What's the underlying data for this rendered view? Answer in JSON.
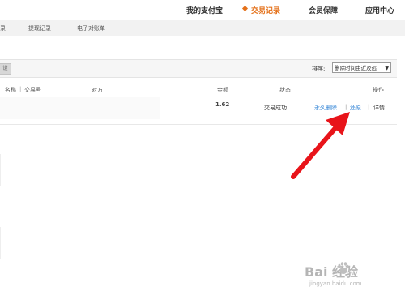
{
  "top_nav": {
    "items": [
      {
        "label": "我的支付宝"
      },
      {
        "label": "交易记录"
      },
      {
        "label": "会员保障"
      },
      {
        "label": "应用中心"
      }
    ]
  },
  "sub_nav": {
    "items": [
      {
        "label": "录"
      },
      {
        "label": "提现记录"
      },
      {
        "label": "电子对账单"
      }
    ]
  },
  "toolbar": {
    "button_label": "设",
    "sort_label": "排序:",
    "sort_value": "删除时间由近及远"
  },
  "table": {
    "headers": [
      "名称",
      "交易号",
      "对方",
      "金额",
      "状态",
      "操作"
    ],
    "header_sep": "|",
    "rows": [
      {
        "amount": "1.62",
        "status": "交易成功",
        "actions": {
          "delete": "永久删除",
          "restore": "还原",
          "detail": "详情",
          "sep": "|"
        }
      }
    ]
  },
  "watermark": {
    "logo": "Bai 经验",
    "url": "jingyan.baidu.com"
  },
  "colors": {
    "accent_orange": "#e4711a",
    "link_blue": "#2a7fd4",
    "annotation_red": "#e8141a"
  }
}
